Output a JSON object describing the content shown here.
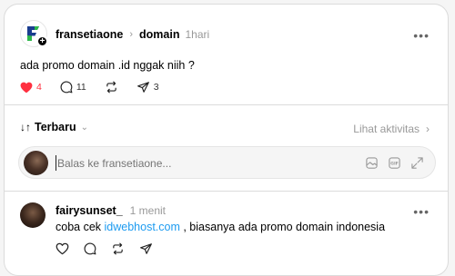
{
  "post": {
    "username": "fransetiaone",
    "topic": "domain",
    "time": "1hari",
    "text": "ada promo domain .id nggak niih ?",
    "likes": "4",
    "comments": "11",
    "shares": "3",
    "liked": true,
    "like_color": "#ff3040"
  },
  "sort": {
    "label": "Terbaru",
    "activity_label": "Lihat aktivitas"
  },
  "reply": {
    "placeholder": "Balas ke fransetiaone..."
  },
  "comment": {
    "username": "fairysunset_",
    "time": "1 menit",
    "text_before": "coba cek ",
    "link": "idwebhost.com",
    "text_after": " , biasanya ada promo domain indonesia",
    "link_color": "#1d9bf0"
  },
  "icons": [
    "logo-icon",
    "plus-icon",
    "more-icon",
    "heart-icon",
    "comment-icon",
    "repost-icon",
    "share-icon",
    "sort-icon",
    "chevron-down-icon",
    "chevron-right-icon",
    "image-icon",
    "gif-icon",
    "expand-icon"
  ]
}
